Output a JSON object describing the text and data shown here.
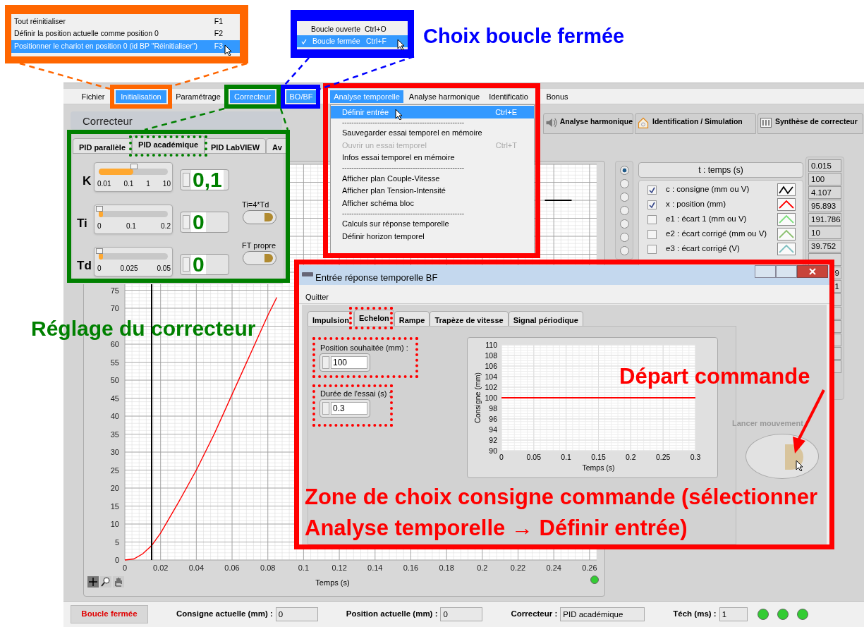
{
  "menu_bar": [
    {
      "label": "Fichier",
      "selected": false
    },
    {
      "label": "Initialisation",
      "selected": true
    },
    {
      "label": "Paramétrage",
      "selected": false
    },
    {
      "label": "Correcteur",
      "selected": true
    },
    {
      "label": "BO/BF",
      "selected": true
    },
    {
      "label": "Analyse temporelle",
      "selected": true
    },
    {
      "label": "Analyse harmonique",
      "selected": false
    },
    {
      "label": "Identificatio",
      "selected": false
    },
    {
      "label": "Bonus",
      "selected": false
    }
  ],
  "panel_title": "Correcteur",
  "main_tabs": [
    {
      "label": "Analyse harmonique",
      "kind": "speaker"
    },
    {
      "label": "Identification  / Simulation",
      "kind": "identification"
    },
    {
      "label": "Synthèse de correcteur",
      "kind": "synthese"
    }
  ],
  "correcteur": {
    "tabs": [
      {
        "label": "PID parallèle",
        "selected": false
      },
      {
        "label": "PID académique",
        "selected": true
      },
      {
        "label": "PID LabVIEW",
        "selected": false
      },
      {
        "label": "Av",
        "selected": false
      }
    ],
    "params": [
      {
        "label": "K",
        "level": 0.5,
        "ticks": [
          "0.01",
          "0.1",
          "1",
          "10"
        ],
        "value": "0,1"
      },
      {
        "label": "Ti",
        "level": 0,
        "ticks": [
          "0",
          "0.1",
          "0.2"
        ],
        "value": "0"
      },
      {
        "label": "Td",
        "level": 0,
        "ticks": [
          "0",
          "0.025",
          "0.05"
        ],
        "value": "0"
      }
    ],
    "toggles": [
      "Ti=4*Td",
      "FT propre"
    ]
  },
  "chart": {
    "chart_data": {
      "type": "line",
      "xlabel": "Temps (s)",
      "x": [
        0,
        0.005,
        0.01,
        0.015,
        0.02,
        0.03,
        0.04,
        0.05,
        0.06,
        0.07,
        0.08,
        0.085,
        0.235,
        0.25
      ],
      "xlim": [
        0,
        0.264
      ],
      "ylim": [
        0,
        110
      ],
      "grid": true,
      "xticks": [
        0,
        0.02,
        0.04,
        0.06,
        0.08,
        0.1,
        0.12,
        0.14,
        0.16,
        0.18,
        0.2,
        0.22,
        0.24,
        0.26
      ],
      "yticks": [
        0,
        5,
        10,
        15,
        20,
        25,
        30,
        35,
        40,
        45,
        50,
        55,
        60,
        70,
        75
      ],
      "series": [
        {
          "color": "#000000",
          "values": [
            null,
            null,
            null,
            null,
            null,
            null,
            null,
            null,
            null,
            null,
            null,
            null,
            100,
            100
          ]
        },
        {
          "color": "#ff0000",
          "values": [
            0,
            0.3,
            1.7,
            4,
            7.5,
            16,
            25,
            35,
            46,
            57,
            68,
            73,
            null,
            null
          ]
        }
      ],
      "ref_lines": [
        {
          "axis": "x",
          "value": 0.015,
          "color": "#000000"
        }
      ]
    }
  },
  "legend": {
    "header": "t : temps (s)",
    "radios": [
      {
        "selected": true
      },
      {
        "selected": false
      },
      {
        "selected": false
      },
      {
        "selected": false
      },
      {
        "selected": false
      },
      {
        "selected": false
      },
      {
        "selected": false
      }
    ],
    "rows": [
      {
        "label": "c : consigne (mm ou V)",
        "checked": true,
        "color": "#000000"
      },
      {
        "label": "x : position (mm)",
        "checked": true,
        "color": "#ff0000"
      },
      {
        "label": "e1 : écart 1 (mm ou V)",
        "checked": false,
        "color": "#7ee07e"
      },
      {
        "label": "e2 : écart corrigé (mm ou V)",
        "checked": false,
        "color": "#8cc070"
      },
      {
        "label": "e3 : écart corrigé (V)",
        "checked": false,
        "color": "#7ec0c0"
      }
    ],
    "values": [
      {
        "text": "0.015",
        "kind": "full"
      },
      {
        "text": "100",
        "kind": "full"
      },
      {
        "text": "4.107",
        "kind": "full"
      },
      {
        "text": "95.893",
        "kind": "full"
      },
      {
        "text": "191.786",
        "kind": "full"
      },
      {
        "text": "10",
        "kind": "full"
      },
      {
        "text": "39.752",
        "kind": "full"
      },
      {
        "kind": "empty"
      },
      {
        "text": "9",
        "kind": "partial"
      },
      {
        "text": "1",
        "kind": "partial"
      }
    ]
  },
  "analyse_menu": [
    {
      "kind": "item",
      "label": "Définir entrée",
      "shortcut": "Ctrl+E",
      "selected": true,
      "disabled": false
    },
    {
      "kind": "separator",
      "label": "----------------------------------------------------"
    },
    {
      "kind": "item",
      "label": "Sauvegarder essai temporel en mémoire",
      "selected": false,
      "disabled": false
    },
    {
      "kind": "item",
      "label": "Ouvrir un essai temporel",
      "shortcut": "Ctrl+T",
      "selected": false,
      "disabled": true
    },
    {
      "kind": "item",
      "label": "Infos essai temporel en mémoire",
      "selected": false,
      "disabled": false
    },
    {
      "kind": "separator",
      "label": "----------------------------------------------------"
    },
    {
      "kind": "item",
      "label": "Afficher plan Couple-Vitesse",
      "selected": false,
      "disabled": false
    },
    {
      "kind": "item",
      "label": "Afficher plan Tension-Intensité",
      "selected": false,
      "disabled": false
    },
    {
      "kind": "item",
      "label": "Afficher schéma bloc",
      "selected": false,
      "disabled": false
    },
    {
      "kind": "separator",
      "label": "----------------------------------------------------"
    },
    {
      "kind": "item",
      "label": "Calculs sur réponse temporelle",
      "selected": false,
      "disabled": false
    },
    {
      "kind": "item",
      "label": "Définir horizon temporel",
      "selected": false,
      "disabled": false
    }
  ],
  "dialog": {
    "title": "Entrée réponse temporelle BF",
    "menu": "Quitter",
    "tabs": [
      {
        "label": "Impulsion",
        "selected": false
      },
      {
        "label": "Echelon",
        "selected": true
      },
      {
        "label": "Rampe",
        "selected": false
      },
      {
        "label": "Trapèze de vitesse",
        "selected": false
      },
      {
        "label": "Signal périodique",
        "selected": false
      }
    ],
    "fields": [
      {
        "label": "Position souhaitée (mm) :",
        "value": "100"
      },
      {
        "label": "Durée de l'essai (s) :",
        "value": "0.3"
      }
    ],
    "chart": {
      "chart_data": {
        "type": "line",
        "xlabel": "Temps (s)",
        "ylabel": "Consigne (mm)",
        "x": [
          0,
          0.3
        ],
        "xlim": [
          0,
          0.3
        ],
        "ylim": [
          90,
          110
        ],
        "grid": true,
        "xticks": [
          0,
          0.05,
          0.1,
          0.15,
          0.2,
          0.25,
          0.3
        ],
        "yticks": [
          90,
          92,
          94,
          96,
          98,
          100,
          102,
          104,
          106,
          108,
          110
        ],
        "series": [
          {
            "color": "#ff0000",
            "values": [
              100,
              100
            ]
          }
        ]
      }
    },
    "button_label": "Lancer mouvement"
  },
  "status_bar": {
    "mode": "Boucle fermée",
    "fields": [
      {
        "label": "Consigne actuelle (mm) :",
        "value": "0"
      },
      {
        "label": "Position actuelle (mm) :",
        "value": "0"
      },
      {
        "label": "Correcteur :",
        "value": "PID académique"
      },
      {
        "label": "Téch (ms) :",
        "value": "1"
      }
    ]
  },
  "callouts": {
    "initialisation_menu": [
      {
        "label": "Tout réinitialiser",
        "shortcut": "F1",
        "selected": false
      },
      {
        "label": "Définir la position actuelle comme position 0",
        "shortcut": "F2",
        "selected": false
      },
      {
        "label": "Positionner le chariot en position 0 (id BP \"Réinitialiser\")",
        "shortcut": "F3",
        "selected": true
      }
    ],
    "boucle_menu": [
      {
        "label": "Boucle ouverte",
        "shortcut": "Ctrl+O",
        "checked": false,
        "selected": false
      },
      {
        "label": "Boucle fermée",
        "shortcut": "Ctrl+F",
        "checked": true,
        "selected": true
      }
    ],
    "notes": [
      {
        "text": "Choix boucle fermée",
        "color": "#0000ff"
      },
      {
        "text": "Réglage du correcteur",
        "color": "#008000"
      },
      {
        "text": "Départ commande",
        "color": "#ff0000"
      },
      {
        "text": "Zone de choix consigne commande (sélectionner\nAnalyse temporelle → Définir entrée)",
        "color": "#ff0000"
      }
    ]
  }
}
